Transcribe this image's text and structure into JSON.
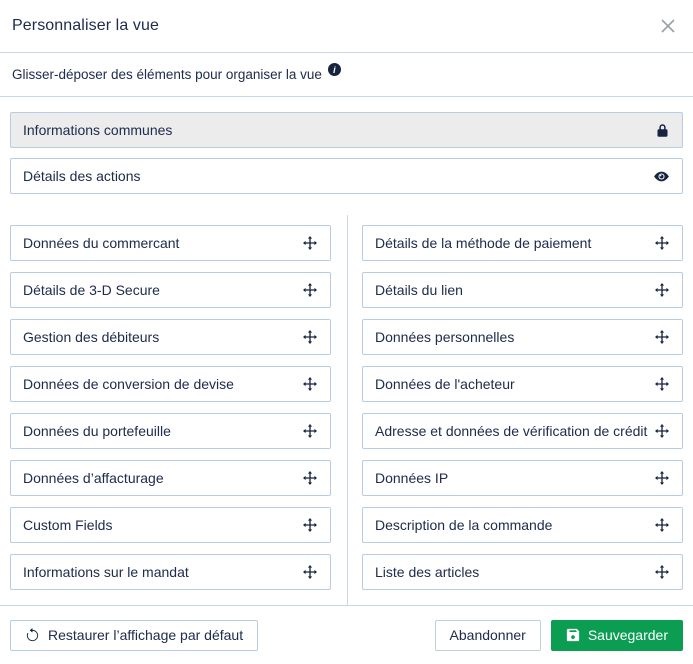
{
  "modal": {
    "title": "Personnaliser la vue",
    "subtitle": "Glisser-déposer des éléments pour organiser la vue",
    "info_icon_glyph": "i",
    "close_icon": "close-icon"
  },
  "fixed_sections": [
    {
      "label": "Informations communes",
      "icon": "lock-icon",
      "locked": true
    },
    {
      "label": "Détails des actions",
      "icon": "eye-icon",
      "locked": false
    }
  ],
  "columns": {
    "left": [
      {
        "label": "Données du commercant",
        "icon": "move-icon"
      },
      {
        "label": "Détails de 3-D Secure",
        "icon": "move-icon"
      },
      {
        "label": "Gestion des débiteurs",
        "icon": "move-icon"
      },
      {
        "label": "Données de conversion de devise",
        "icon": "move-icon"
      },
      {
        "label": "Données du portefeuille",
        "icon": "move-icon"
      },
      {
        "label": "Données d’affacturage",
        "icon": "move-icon"
      },
      {
        "label": "Custom Fields",
        "icon": "move-icon"
      },
      {
        "label": "Informations sur le mandat",
        "icon": "move-icon"
      }
    ],
    "right": [
      {
        "label": "Détails de la méthode de paiement",
        "icon": "move-icon"
      },
      {
        "label": "Détails du lien",
        "icon": "move-icon"
      },
      {
        "label": "Données personnelles",
        "icon": "move-icon"
      },
      {
        "label": "Données de l'acheteur",
        "icon": "move-icon"
      },
      {
        "label": "Adresse et données de vérification de crédit",
        "icon": "move-icon"
      },
      {
        "label": "Données IP",
        "icon": "move-icon"
      },
      {
        "label": "Description de la commande",
        "icon": "move-icon"
      },
      {
        "label": "Liste des articles",
        "icon": "move-icon"
      }
    ]
  },
  "footer": {
    "restore_label": "Restaurer l’affichage par défaut",
    "restore_icon": "undo-icon",
    "cancel_label": "Abandonner",
    "save_label": "Sauvegarder",
    "save_icon": "save-icon"
  },
  "colors": {
    "accent_green": "#0b9e52",
    "text_navy": "#202c4d",
    "border_blue": "#b9cde2",
    "divider": "#c9d7e6",
    "locked_background": "#ececec",
    "icon_navy": "#17243f",
    "close_gray": "#98a0a8"
  }
}
